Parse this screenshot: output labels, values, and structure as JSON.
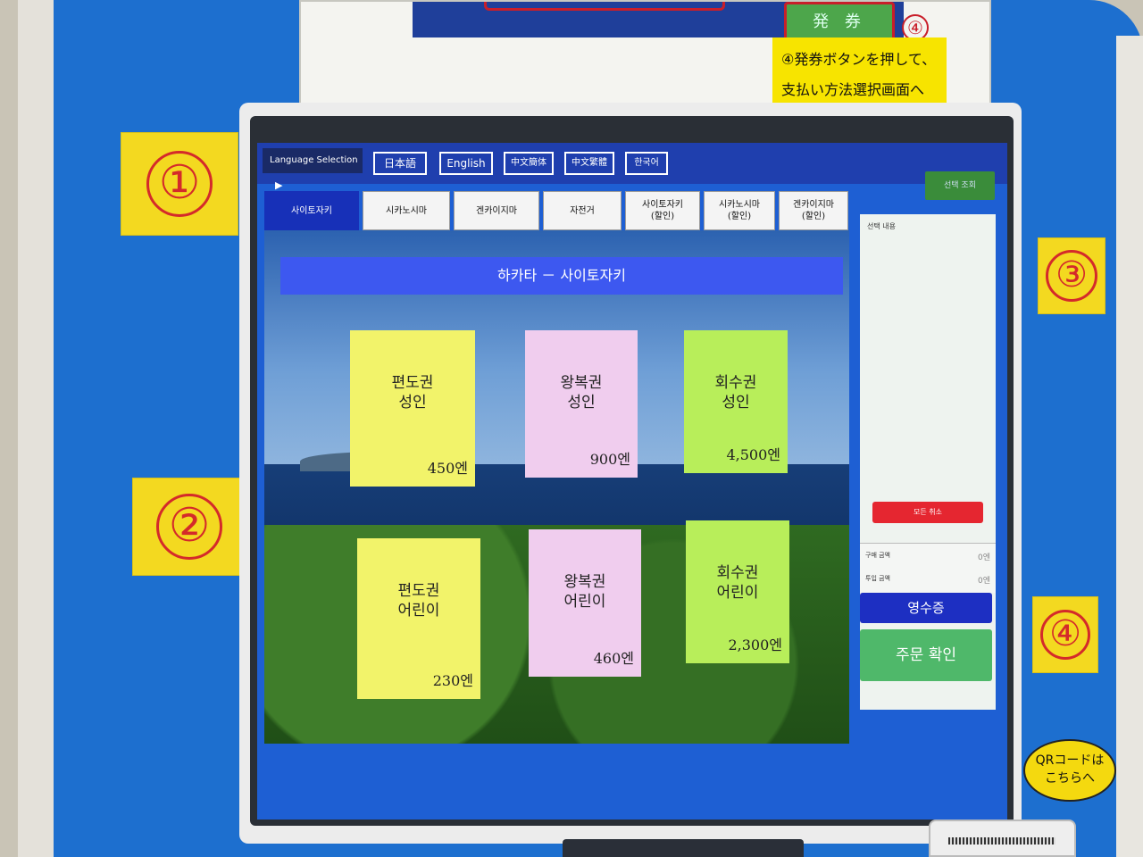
{
  "top_panel": {
    "issue_button": "発 券",
    "step_number": "④",
    "step_note_line1": "④発券ボタンを押して、",
    "step_note_line2": "支払い方法選択画面へ"
  },
  "stickers": [
    "①",
    "②",
    "③",
    "④"
  ],
  "language_bar": {
    "label": "Language Selection",
    "arrow": "▶",
    "languages": [
      "日本語",
      "English",
      "中文簡体",
      "中文繁體",
      "한국어"
    ],
    "search_button": "선택 조회"
  },
  "tabs": [
    {
      "label": "사이토자키",
      "active": true
    },
    {
      "label": "시카노시마",
      "active": false
    },
    {
      "label": "겐카이지마",
      "active": false
    },
    {
      "label": "자전거",
      "active": false
    },
    {
      "label": "사이토자키\n(할인)",
      "active": false
    },
    {
      "label": "시카노시마\n(할인)",
      "active": false
    },
    {
      "label": "겐카이지마\n(할인)",
      "active": false
    }
  ],
  "route_title": "하카타 － 사이토자키",
  "tickets": [
    {
      "line1": "편도권",
      "line2": "성인",
      "price": "450엔",
      "color": "#f2f36a"
    },
    {
      "line1": "왕복권",
      "line2": "성인",
      "price": "900엔",
      "color": "#f0cdee"
    },
    {
      "line1": "회수권",
      "line2": "성인",
      "price": "4,500엔",
      "color": "#b8ee5a"
    },
    {
      "line1": "편도권",
      "line2": "어린이",
      "price": "230엔",
      "color": "#f2f36a"
    },
    {
      "line1": "왕복권",
      "line2": "어린이",
      "price": "460엔",
      "color": "#f0cdee"
    },
    {
      "line1": "회수권",
      "line2": "어린이",
      "price": "2,300엔",
      "color": "#b8ee5a"
    }
  ],
  "side_panel": {
    "title": "선택 내용",
    "clear_all": "모든 취소",
    "purchase_label": "구매 금액",
    "purchase_amount": "0엔",
    "deposit_label": "투입 금액",
    "deposit_amount": "0엔",
    "receipt": "영수증",
    "confirm": "주문 확인"
  },
  "qr_note": {
    "line1": "QRコードは",
    "line2": "こちらへ"
  }
}
